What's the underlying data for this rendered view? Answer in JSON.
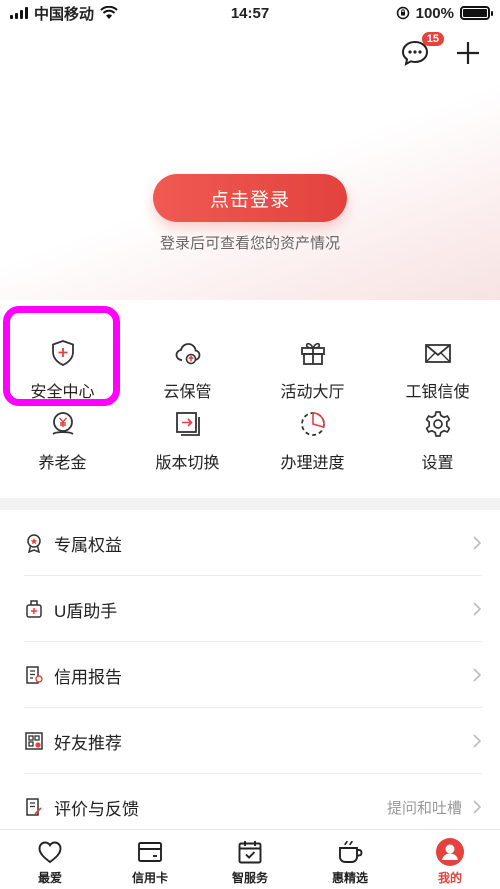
{
  "status_bar": {
    "carrier": "中国移动",
    "time": "14:57",
    "battery": "100%"
  },
  "header": {
    "message_badge": "15"
  },
  "login": {
    "button_label": "点击登录",
    "subtitle": "登录后可查看您的资产情况"
  },
  "grid": {
    "items": [
      {
        "label": "安全中心",
        "icon": "shield-icon"
      },
      {
        "label": "云保管",
        "icon": "cloud-icon"
      },
      {
        "label": "活动大厅",
        "icon": "gift-icon"
      },
      {
        "label": "工银信使",
        "icon": "envelope-icon"
      },
      {
        "label": "养老金",
        "icon": "pension-coin-icon"
      },
      {
        "label": "版本切换",
        "icon": "switch-icon"
      },
      {
        "label": "办理进度",
        "icon": "progress-icon"
      },
      {
        "label": "设置",
        "icon": "gear-icon"
      }
    ]
  },
  "list": {
    "items": [
      {
        "label": "专属权益",
        "extra": "",
        "icon": "medal-icon"
      },
      {
        "label": "U盾助手",
        "extra": "",
        "icon": "usb-key-icon"
      },
      {
        "label": "信用报告",
        "extra": "",
        "icon": "report-icon"
      },
      {
        "label": "好友推荐",
        "extra": "",
        "icon": "qr-share-icon"
      },
      {
        "label": "评价与反馈",
        "extra": "提问和吐槽",
        "icon": "feedback-icon"
      }
    ]
  },
  "tabbar": {
    "tabs": [
      {
        "label": "最爱",
        "icon": "heart-icon"
      },
      {
        "label": "信用卡",
        "icon": "credit-card-icon"
      },
      {
        "label": "智服务",
        "icon": "calendar-icon"
      },
      {
        "label": "惠精选",
        "icon": "cup-icon"
      },
      {
        "label": "我的",
        "icon": "profile-icon"
      }
    ],
    "active_index": 4
  },
  "colors": {
    "brand_red": "#e3423d",
    "highlight": "#ff00ff"
  }
}
